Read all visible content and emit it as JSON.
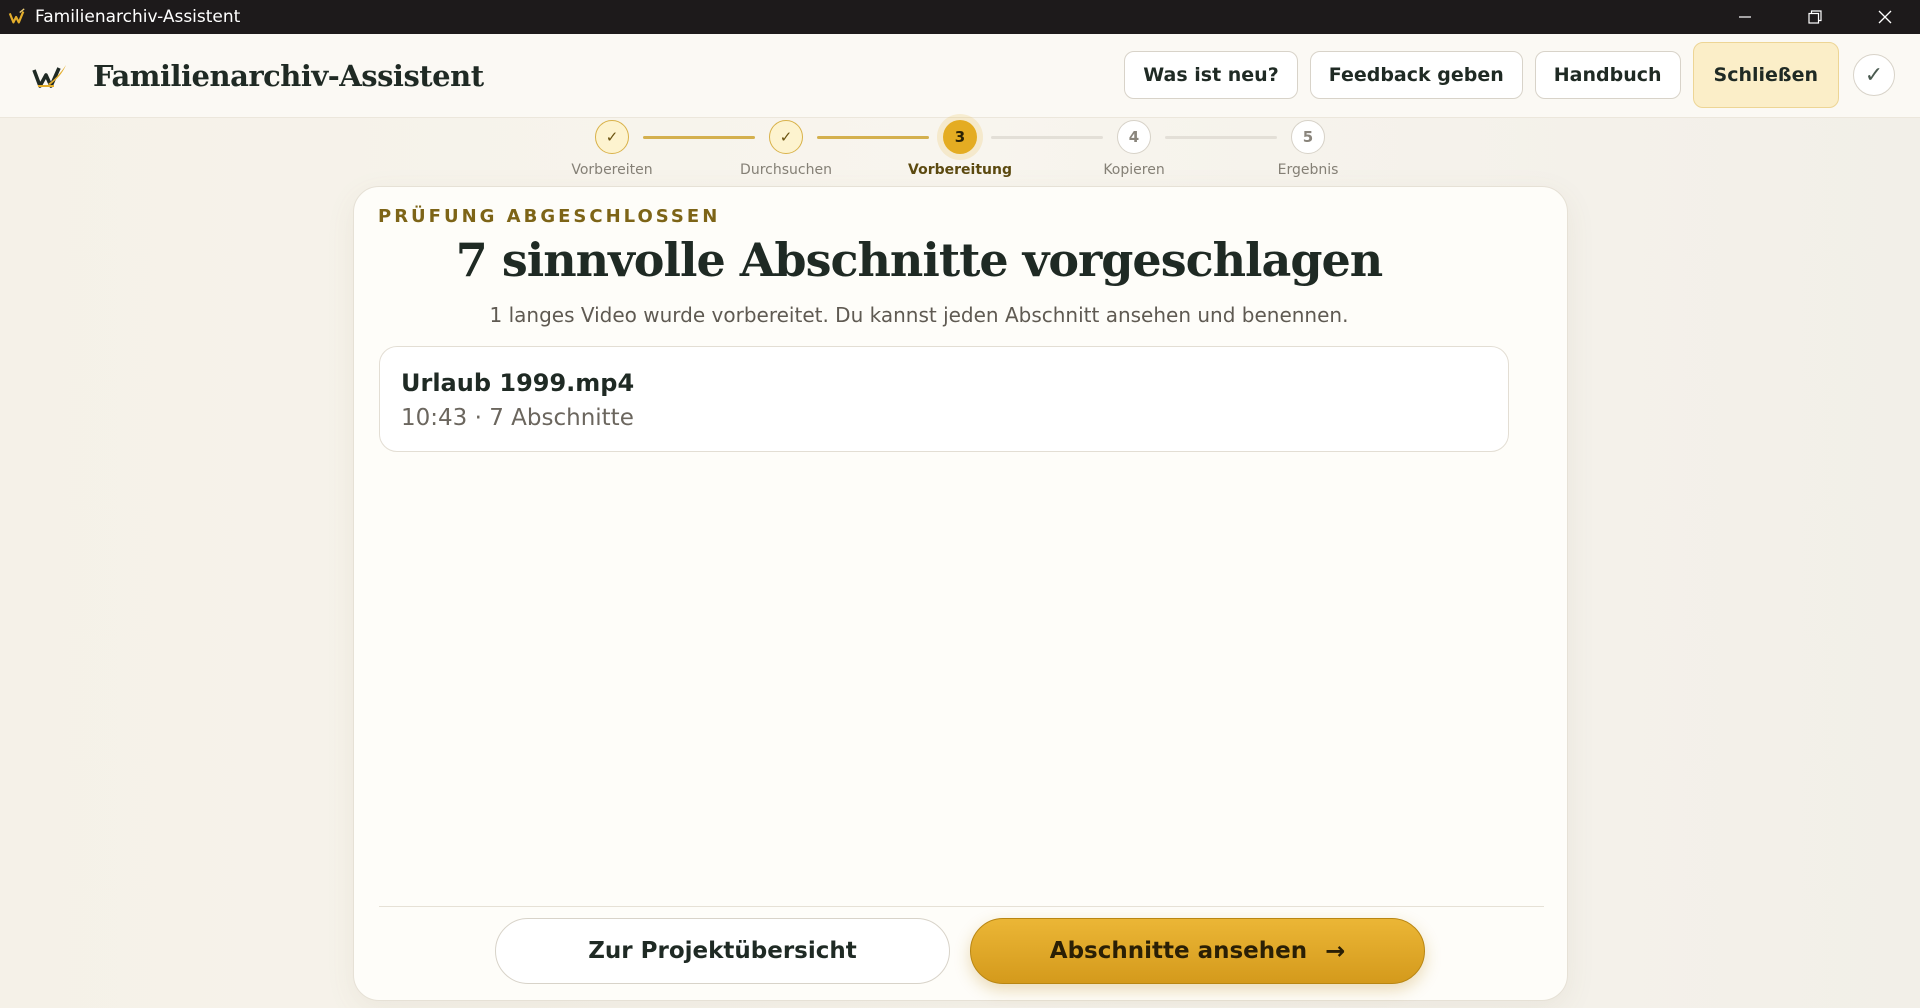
{
  "window": {
    "title": "Familienarchiv-Assistent"
  },
  "header": {
    "app_title": "Familienarchiv-Assistent",
    "buttons": {
      "whats_new": "Was ist neu?",
      "feedback": "Feedback geben",
      "manual": "Handbuch",
      "close": "Schließen",
      "status_check": "✓"
    }
  },
  "stepper": {
    "current_step": 3,
    "steps": [
      {
        "marker": "✓",
        "label": "Vorbereiten",
        "state": "done"
      },
      {
        "marker": "✓",
        "label": "Durchsuchen",
        "state": "done"
      },
      {
        "marker": "3",
        "label": "Vorbereitung",
        "state": "active"
      },
      {
        "marker": "4",
        "label": "Kopieren",
        "state": "todo"
      },
      {
        "marker": "5",
        "label": "Ergebnis",
        "state": "todo"
      }
    ]
  },
  "main": {
    "eyebrow": "PRÜFUNG ABGESCHLOSSEN",
    "headline": "7 sinnvolle Abschnitte vorgeschlagen",
    "subline": "1 langes Video wurde vorbereitet. Du kannst jeden Abschnitt ansehen und benennen.",
    "videos": [
      {
        "name": "Urlaub 1999.mp4",
        "meta": "10:43 · 7 Abschnitte"
      }
    ],
    "actions": {
      "back": "Zur Projektübersicht",
      "continue": "Abschnitte ansehen",
      "continue_icon": "→"
    }
  },
  "colors": {
    "accent": "#e4ac22",
    "accent_dark": "#d49a1c",
    "eyebrow": "#7d6417",
    "titlebar": "#1d1a1b",
    "text": "#1f2a24"
  },
  "icons": {
    "app_logo": "wm-feather-logo-icon",
    "minimize": "minimize-icon",
    "restore": "restore-icon",
    "close": "close-icon",
    "step_done": "checkmark-icon",
    "continue_arrow": "arrow-right-icon"
  }
}
